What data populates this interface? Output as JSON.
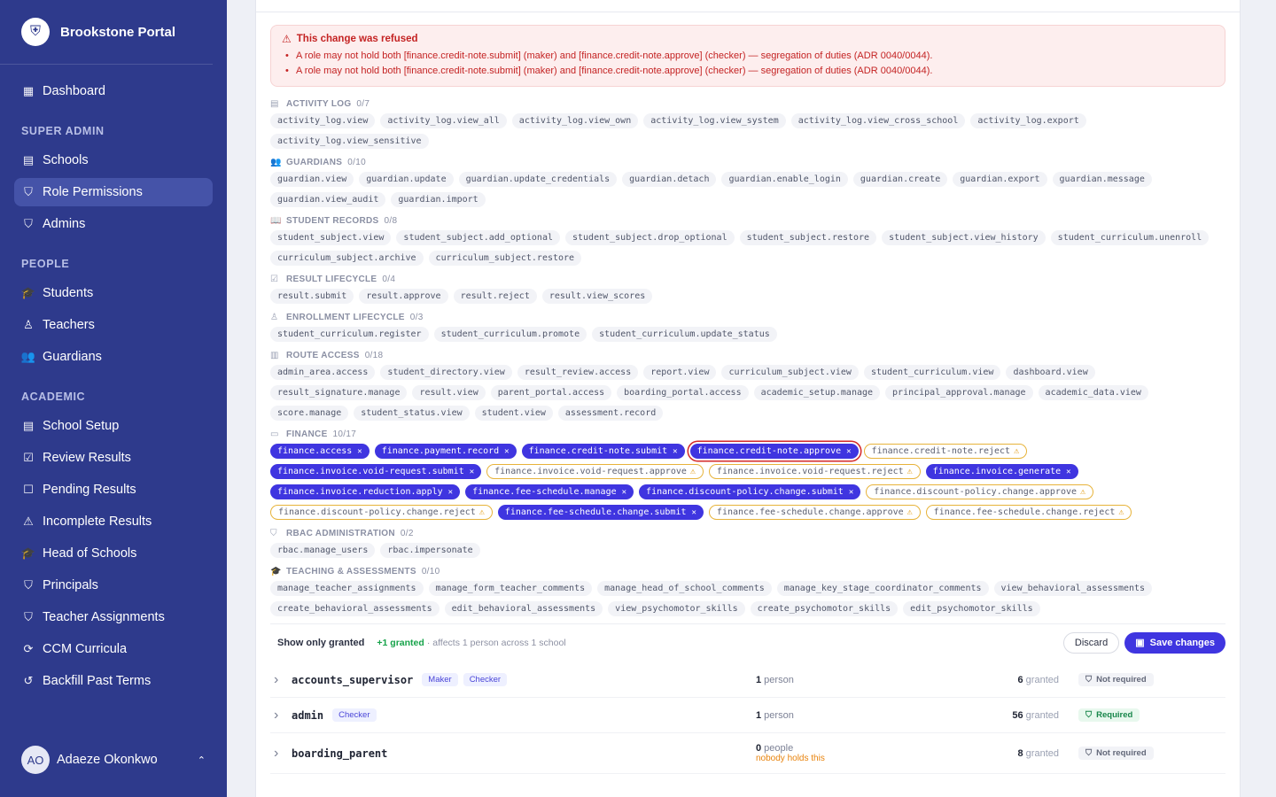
{
  "brand": {
    "name": "Brookstone Portal",
    "logo_icon": "shield-crest-icon"
  },
  "sidebar": {
    "top": [
      {
        "label": "Dashboard",
        "icon": "▦",
        "icon_name": "dashboard-icon"
      }
    ],
    "sections": [
      {
        "title": "SUPER ADMIN",
        "items": [
          {
            "label": "Schools",
            "icon": "▤",
            "icon_name": "building-icon"
          },
          {
            "label": "Role Permissions",
            "icon": "⛉",
            "icon_name": "shield-icon",
            "active": true
          },
          {
            "label": "Admins",
            "icon": "⛉",
            "icon_name": "shield-icon"
          }
        ]
      },
      {
        "title": "PEOPLE",
        "items": [
          {
            "label": "Students",
            "icon": "🎓",
            "icon_name": "graduation-cap-icon"
          },
          {
            "label": "Teachers",
            "icon": "♙",
            "icon_name": "user-icon"
          },
          {
            "label": "Guardians",
            "icon": "👥",
            "icon_name": "users-icon"
          }
        ]
      },
      {
        "title": "ACADEMIC",
        "items": [
          {
            "label": "School Setup",
            "icon": "▤",
            "icon_name": "building-icon"
          },
          {
            "label": "Review Results",
            "icon": "☑",
            "icon_name": "clipboard-check-icon"
          },
          {
            "label": "Pending Results",
            "icon": "☐",
            "icon_name": "clipboard-pen-icon"
          },
          {
            "label": "Incomplete Results",
            "icon": "⚠",
            "icon_name": "warning-icon"
          },
          {
            "label": "Head of Schools",
            "icon": "🎓",
            "icon_name": "graduation-cap-icon"
          },
          {
            "label": "Principals",
            "icon": "⛉",
            "icon_name": "shield-icon"
          },
          {
            "label": "Teacher Assignments",
            "icon": "⛉",
            "icon_name": "shield-icon"
          },
          {
            "label": "CCM Curricula",
            "icon": "⟳",
            "icon_name": "refresh-icon"
          },
          {
            "label": "Backfill Past Terms",
            "icon": "↺",
            "icon_name": "history-icon"
          }
        ]
      }
    ],
    "user": {
      "initials": "AO",
      "name": "Adaeze Okonkwo"
    }
  },
  "alert": {
    "title": "This change was refused",
    "messages": [
      "A role may not hold both [finance.credit-note.submit] (maker) and [finance.credit-note.approve] (checker) — segregation of duties (ADR 0040/0044).",
      "A role may not hold both [finance.credit-note.submit] (maker) and [finance.credit-note.approve] (checker) — segregation of duties (ADR 0040/0044)."
    ]
  },
  "groups": [
    {
      "name": "ACTIVITY LOG",
      "count": "0/7",
      "icon": "▤",
      "icon_name": "log-icon",
      "chips": [
        {
          "t": "activity_log.view"
        },
        {
          "t": "activity_log.view_all"
        },
        {
          "t": "activity_log.view_own"
        },
        {
          "t": "activity_log.view_system"
        },
        {
          "t": "activity_log.view_cross_school"
        },
        {
          "t": "activity_log.export"
        },
        {
          "t": "activity_log.view_sensitive"
        }
      ]
    },
    {
      "name": "GUARDIANS",
      "count": "0/10",
      "icon": "👥",
      "icon_name": "users-icon",
      "chips": [
        {
          "t": "guardian.view"
        },
        {
          "t": "guardian.update"
        },
        {
          "t": "guardian.update_credentials"
        },
        {
          "t": "guardian.detach"
        },
        {
          "t": "guardian.enable_login"
        },
        {
          "t": "guardian.create"
        },
        {
          "t": "guardian.export"
        },
        {
          "t": "guardian.message"
        },
        {
          "t": "guardian.view_audit"
        },
        {
          "t": "guardian.import"
        }
      ]
    },
    {
      "name": "STUDENT RECORDS",
      "count": "0/8",
      "icon": "📖",
      "icon_name": "book-icon",
      "chips": [
        {
          "t": "student_subject.view"
        },
        {
          "t": "student_subject.add_optional"
        },
        {
          "t": "student_subject.drop_optional"
        },
        {
          "t": "student_subject.restore"
        },
        {
          "t": "student_subject.view_history"
        },
        {
          "t": "student_curriculum.unenroll"
        },
        {
          "t": "curriculum_subject.archive"
        },
        {
          "t": "curriculum_subject.restore"
        }
      ]
    },
    {
      "name": "RESULT LIFECYCLE",
      "count": "0/4",
      "icon": "☑",
      "icon_name": "clipboard-icon",
      "chips": [
        {
          "t": "result.submit"
        },
        {
          "t": "result.approve"
        },
        {
          "t": "result.reject"
        },
        {
          "t": "result.view_scores"
        }
      ]
    },
    {
      "name": "ENROLLMENT LIFECYCLE",
      "count": "0/3",
      "icon": "♙",
      "icon_name": "user-plus-icon",
      "chips": [
        {
          "t": "student_curriculum.register"
        },
        {
          "t": "student_curriculum.promote"
        },
        {
          "t": "student_curriculum.update_status"
        }
      ]
    },
    {
      "name": "ROUTE ACCESS",
      "count": "0/18",
      "icon": "▥",
      "icon_name": "building-icon",
      "chips": [
        {
          "t": "admin_area.access"
        },
        {
          "t": "student_directory.view"
        },
        {
          "t": "result_review.access"
        },
        {
          "t": "report.view"
        },
        {
          "t": "curriculum_subject.view"
        },
        {
          "t": "student_curriculum.view"
        },
        {
          "t": "dashboard.view"
        },
        {
          "t": "result_signature.manage"
        },
        {
          "t": "result.view"
        },
        {
          "t": "parent_portal.access"
        },
        {
          "t": "boarding_portal.access"
        },
        {
          "t": "academic_setup.manage"
        },
        {
          "t": "principal_approval.manage"
        },
        {
          "t": "academic_data.view"
        },
        {
          "t": "score.manage"
        },
        {
          "t": "student_status.view"
        },
        {
          "t": "student.view"
        },
        {
          "t": "assessment.record"
        }
      ]
    },
    {
      "name": "FINANCE",
      "count": "10/17",
      "icon": "▭",
      "icon_name": "wallet-icon",
      "chips": [
        {
          "t": "finance.access",
          "s": "granted"
        },
        {
          "t": "finance.payment.record",
          "s": "granted"
        },
        {
          "t": "finance.credit-note.submit",
          "s": "granted"
        },
        {
          "t": "finance.credit-note.approve",
          "s": "refused"
        },
        {
          "t": "finance.credit-note.reject",
          "s": "warn"
        },
        {
          "t": "finance.invoice.void-request.submit",
          "s": "granted"
        },
        {
          "t": "finance.invoice.void-request.approve",
          "s": "warn"
        },
        {
          "t": "finance.invoice.void-request.reject",
          "s": "warn"
        },
        {
          "t": "finance.invoice.generate",
          "s": "granted"
        },
        {
          "t": "finance.invoice.reduction.apply",
          "s": "granted"
        },
        {
          "t": "finance.fee-schedule.manage",
          "s": "granted"
        },
        {
          "t": "finance.discount-policy.change.submit",
          "s": "granted"
        },
        {
          "t": "finance.discount-policy.change.approve",
          "s": "warn"
        },
        {
          "t": "finance.discount-policy.change.reject",
          "s": "warn"
        },
        {
          "t": "finance.fee-schedule.change.submit",
          "s": "granted"
        },
        {
          "t": "finance.fee-schedule.change.approve",
          "s": "warn"
        },
        {
          "t": "finance.fee-schedule.change.reject",
          "s": "warn"
        }
      ]
    },
    {
      "name": "RBAC ADMINISTRATION",
      "count": "0/2",
      "icon": "⛉",
      "icon_name": "shield-icon",
      "chips": [
        {
          "t": "rbac.manage_users"
        },
        {
          "t": "rbac.impersonate"
        }
      ]
    },
    {
      "name": "TEACHING & ASSESSMENTS",
      "count": "0/10",
      "icon": "🎓",
      "icon_name": "graduation-cap-icon",
      "chips": [
        {
          "t": "manage_teacher_assignments"
        },
        {
          "t": "manage_form_teacher_comments"
        },
        {
          "t": "manage_head_of_school_comments"
        },
        {
          "t": "manage_key_stage_coordinator_comments"
        },
        {
          "t": "view_behavioral_assessments"
        },
        {
          "t": "create_behavioral_assessments"
        },
        {
          "t": "edit_behavioral_assessments"
        },
        {
          "t": "view_psychomotor_skills"
        },
        {
          "t": "create_psychomotor_skills"
        },
        {
          "t": "edit_psychomotor_skills"
        }
      ]
    }
  ],
  "footer": {
    "toggle_label": "Show only granted",
    "granted_note": "+1 granted",
    "affects": "· affects 1 person across 1 school",
    "discard": "Discard",
    "save": "Save changes"
  },
  "roles": [
    {
      "name": "accounts_supervisor",
      "tags": [
        "Maker",
        "Checker"
      ],
      "people_n": "1",
      "people_label": " person",
      "granted_n": "6",
      "granted_label": " granted",
      "status": "Not required",
      "status_kind": "notreq"
    },
    {
      "name": "admin",
      "tags": [
        "Checker"
      ],
      "people_n": "1",
      "people_label": " person",
      "granted_n": "56",
      "granted_label": " granted",
      "status": "Required",
      "status_kind": "req"
    },
    {
      "name": "boarding_parent",
      "tags": [],
      "people_n": "0",
      "people_label": " people",
      "people_note": "nobody holds this",
      "granted_n": "8",
      "granted_label": " granted",
      "status": "Not required",
      "status_kind": "notreq"
    }
  ]
}
